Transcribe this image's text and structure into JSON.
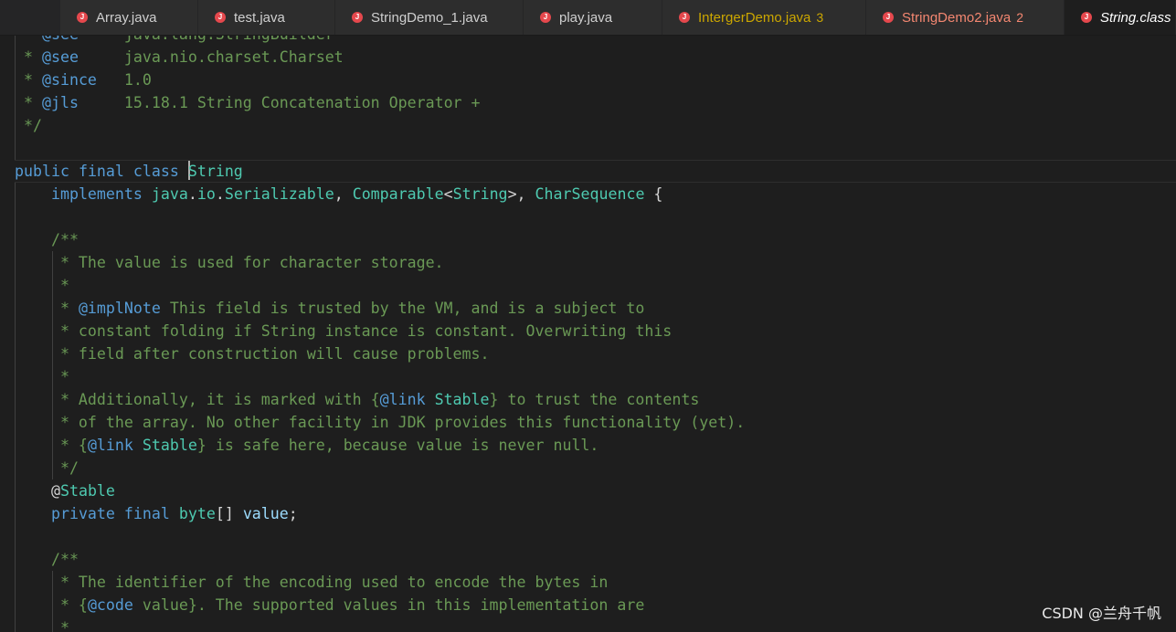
{
  "tabs": [
    {
      "label": "Array.java",
      "badge": ""
    },
    {
      "label": "test.java",
      "badge": ""
    },
    {
      "label": "StringDemo_1.java",
      "badge": ""
    },
    {
      "label": "play.java",
      "badge": ""
    },
    {
      "label": "IntergerDemo.java",
      "badge": "3"
    },
    {
      "label": "StringDemo2.java",
      "badge": "2"
    },
    {
      "label": "String.class",
      "badge": ""
    }
  ],
  "colors": {
    "tab_warning": "#cca700",
    "tab_error": "#f48771",
    "java_icon": "#e5484d",
    "comment": "#6a9955",
    "keyword": "#569cd6",
    "type": "#4ec9b0",
    "variable": "#9cdcfe"
  },
  "code": [
    {
      "segs": [
        {
          "t": " * ",
          "c": "c"
        },
        {
          "t": "@see",
          "c": "tg"
        },
        {
          "t": "     java.lang.StringBuilder",
          "c": "c"
        }
      ]
    },
    {
      "segs": [
        {
          "t": " * ",
          "c": "c"
        },
        {
          "t": "@see",
          "c": "tg"
        },
        {
          "t": "     java.nio.charset.Charset",
          "c": "c"
        }
      ]
    },
    {
      "segs": [
        {
          "t": " * ",
          "c": "c"
        },
        {
          "t": "@since",
          "c": "tg"
        },
        {
          "t": "   1.0",
          "c": "c"
        }
      ]
    },
    {
      "segs": [
        {
          "t": " * ",
          "c": "c"
        },
        {
          "t": "@jls",
          "c": "tg"
        },
        {
          "t": "     15.18.1 String Concatenation Operator +",
          "c": "c"
        }
      ]
    },
    {
      "segs": [
        {
          "t": " */",
          "c": "c"
        }
      ]
    },
    {
      "segs": []
    },
    {
      "cursor": true,
      "segs": [
        {
          "t": "public",
          "c": "kw"
        },
        {
          "t": " ",
          "c": "pl"
        },
        {
          "t": "final",
          "c": "kw"
        },
        {
          "t": " ",
          "c": "pl"
        },
        {
          "t": "class",
          "c": "kw"
        },
        {
          "t": " ",
          "c": "pl"
        },
        {
          "t": "|",
          "c": "cursor"
        },
        {
          "t": "String",
          "c": "ty"
        }
      ]
    },
    {
      "segs": [
        {
          "t": "    ",
          "c": "pl"
        },
        {
          "t": "implements",
          "c": "kw"
        },
        {
          "t": " ",
          "c": "pl"
        },
        {
          "t": "java",
          "c": "ty"
        },
        {
          "t": ".",
          "c": "pl"
        },
        {
          "t": "io",
          "c": "ty"
        },
        {
          "t": ".",
          "c": "pl"
        },
        {
          "t": "Serializable",
          "c": "ty"
        },
        {
          "t": ", ",
          "c": "pl"
        },
        {
          "t": "Comparable",
          "c": "ty"
        },
        {
          "t": "<",
          "c": "pl"
        },
        {
          "t": "String",
          "c": "ty"
        },
        {
          "t": ">, ",
          "c": "pl"
        },
        {
          "t": "CharSequence",
          "c": "ty"
        },
        {
          "t": " {",
          "c": "pl"
        }
      ]
    },
    {
      "segs": []
    },
    {
      "segs": [
        {
          "t": "    /**",
          "c": "c"
        }
      ]
    },
    {
      "segs": [
        {
          "t": "     * The value is used for character storage.",
          "c": "c"
        }
      ]
    },
    {
      "segs": [
        {
          "t": "     *",
          "c": "c"
        }
      ]
    },
    {
      "segs": [
        {
          "t": "     * ",
          "c": "c"
        },
        {
          "t": "@implNote",
          "c": "tg"
        },
        {
          "t": " This field is trusted by the VM, and is a subject to",
          "c": "c"
        }
      ]
    },
    {
      "segs": [
        {
          "t": "     * constant folding if String instance is constant. Overwriting this",
          "c": "c"
        }
      ]
    },
    {
      "segs": [
        {
          "t": "     * field after construction will cause problems.",
          "c": "c"
        }
      ]
    },
    {
      "segs": [
        {
          "t": "     *",
          "c": "c"
        }
      ]
    },
    {
      "segs": [
        {
          "t": "     * Additionally, it is marked with {",
          "c": "c"
        },
        {
          "t": "@link",
          "c": "tg"
        },
        {
          "t": " ",
          "c": "c"
        },
        {
          "t": "Stable",
          "c": "an"
        },
        {
          "t": "} to trust the contents",
          "c": "c"
        }
      ]
    },
    {
      "segs": [
        {
          "t": "     * of the array. No other facility in JDK provides this functionality (yet).",
          "c": "c"
        }
      ]
    },
    {
      "segs": [
        {
          "t": "     * {",
          "c": "c"
        },
        {
          "t": "@link",
          "c": "tg"
        },
        {
          "t": " ",
          "c": "c"
        },
        {
          "t": "Stable",
          "c": "an"
        },
        {
          "t": "} is safe here, because value is never null.",
          "c": "c"
        }
      ]
    },
    {
      "segs": [
        {
          "t": "     */",
          "c": "c"
        }
      ]
    },
    {
      "segs": [
        {
          "t": "    ",
          "c": "pl"
        },
        {
          "t": "@",
          "c": "pl"
        },
        {
          "t": "Stable",
          "c": "an"
        }
      ]
    },
    {
      "segs": [
        {
          "t": "    ",
          "c": "pl"
        },
        {
          "t": "private",
          "c": "kw"
        },
        {
          "t": " ",
          "c": "pl"
        },
        {
          "t": "final",
          "c": "kw"
        },
        {
          "t": " ",
          "c": "pl"
        },
        {
          "t": "byte",
          "c": "ty"
        },
        {
          "t": "[] ",
          "c": "pl"
        },
        {
          "t": "value",
          "c": "vr"
        },
        {
          "t": ";",
          "c": "pl"
        }
      ]
    },
    {
      "segs": []
    },
    {
      "segs": [
        {
          "t": "    /**",
          "c": "c"
        }
      ]
    },
    {
      "segs": [
        {
          "t": "     * The identifier of the encoding used to encode the bytes in",
          "c": "c"
        }
      ]
    },
    {
      "segs": [
        {
          "t": "     * {",
          "c": "c"
        },
        {
          "t": "@code",
          "c": "tg"
        },
        {
          "t": " value}. The supported values in this implementation are",
          "c": "c"
        }
      ]
    },
    {
      "segs": [
        {
          "t": "     *",
          "c": "c"
        }
      ]
    }
  ],
  "watermark": "CSDN @兰舟千帆"
}
